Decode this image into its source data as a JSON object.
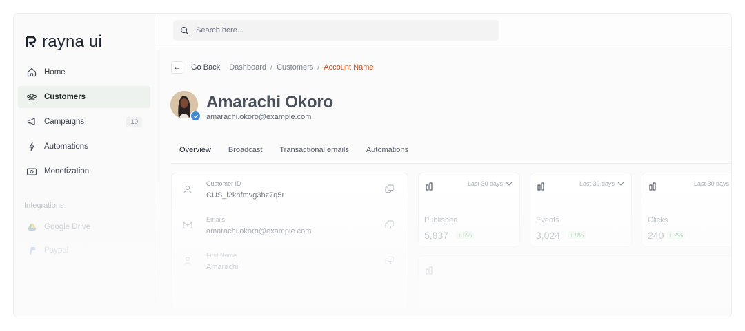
{
  "brand": {
    "name": "rayna ui"
  },
  "sidebar": {
    "items": [
      {
        "label": "Home",
        "icon": "home-icon"
      },
      {
        "label": "Customers",
        "icon": "users-icon",
        "active": true
      },
      {
        "label": "Campaigns",
        "icon": "megaphone-icon",
        "count": "10"
      },
      {
        "label": "Automations",
        "icon": "bolt-icon"
      },
      {
        "label": "Monetization",
        "icon": "cash-icon"
      }
    ],
    "section_title": "Integrations",
    "integrations": [
      {
        "label": "Google Drive",
        "icon": "google-drive-icon"
      },
      {
        "label": "Paypal",
        "icon": "paypal-icon"
      }
    ]
  },
  "search": {
    "placeholder": "Search here..."
  },
  "breadcrumb": {
    "back_label": "Go Back",
    "items": [
      "Dashboard",
      "Customers"
    ],
    "current": "Account Name",
    "separator": "/"
  },
  "profile": {
    "name": "Amarachi Okoro",
    "email": "amarachi.okoro@example.com"
  },
  "tabs": [
    "Overview",
    "Broadcast",
    "Transactional emails",
    "Automations"
  ],
  "info": [
    {
      "label": "Customer ID",
      "value": "CUS_i2khfmvg3bz7q5r",
      "icon": "id-icon"
    },
    {
      "label": "Emails",
      "value": "amarachi.okoro@example.com",
      "icon": "mail-icon"
    },
    {
      "label": "First Name",
      "value": "Amarachi",
      "icon": "user-icon"
    }
  ],
  "stats": [
    {
      "label": "Published",
      "value": "5,837",
      "change": "5%",
      "range": "Last 30 days"
    },
    {
      "label": "Events",
      "value": "3,024",
      "change": "8%",
      "range": "Last 30 days"
    },
    {
      "label": "Clicks",
      "value": "240",
      "change": "2%",
      "range": "Last 30 days"
    }
  ],
  "colors": {
    "accent_breadcrumb": "#c2511b",
    "active_nav_bg": "#edf2ee",
    "verified_badge": "#3f8ad6",
    "positive_change": "#7fae8c"
  }
}
